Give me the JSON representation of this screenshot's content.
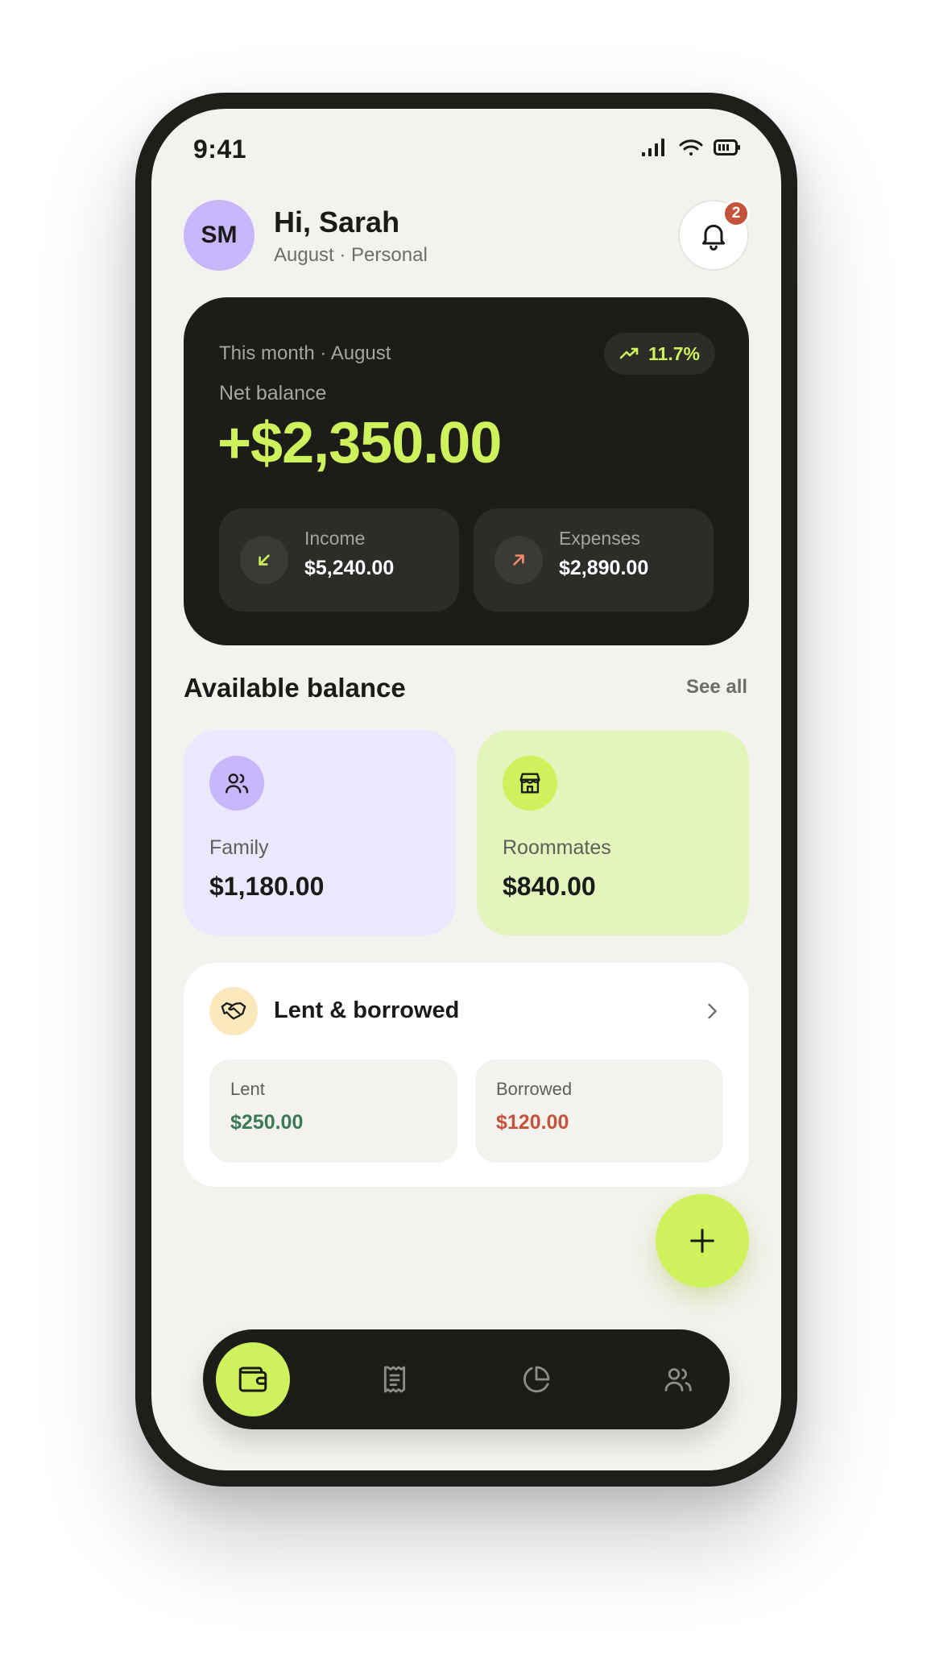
{
  "status_bar": {
    "time": "9:41"
  },
  "header": {
    "avatar_initials": "SM",
    "greeting": "Hi, Sarah",
    "subtitle": "August · Personal",
    "notification_count": "2"
  },
  "net_card": {
    "period": "This month · August",
    "trend": "11.7%",
    "label": "Net balance",
    "amount": "+$2,350.00",
    "income_label": "Income",
    "income_value": "$5,240.00",
    "expenses_label": "Expenses",
    "expenses_value": "$2,890.00"
  },
  "available": {
    "title": "Available balance",
    "see_all": "See all",
    "cards": [
      {
        "label": "Family",
        "value": "$1,180.00",
        "icon": "users-icon",
        "bg": "#ebe8fd",
        "icon_bg": "#c8b8fb"
      },
      {
        "label": "Roommates",
        "value": "$840.00",
        "icon": "store-icon",
        "bg": "#e3f5bd",
        "icon_bg": "#cdf25b"
      }
    ]
  },
  "lent_borrowed": {
    "title": "Lent & borrowed",
    "lent_label": "Lent",
    "lent_value": "$250.00",
    "borrowed_label": "Borrowed",
    "borrowed_value": "$120.00"
  },
  "nav": {
    "items": [
      {
        "icon": "wallet-icon",
        "active": true
      },
      {
        "icon": "receipt-icon",
        "active": false
      },
      {
        "icon": "pie-chart-icon",
        "active": false
      },
      {
        "icon": "users-icon",
        "active": false
      }
    ]
  },
  "colors": {
    "accent": "#cdf25b",
    "dark": "#1c1c19",
    "background": "#f3f2ee",
    "positive": "#3a7a55",
    "negative": "#c5533c",
    "badge": "#c5533c"
  }
}
